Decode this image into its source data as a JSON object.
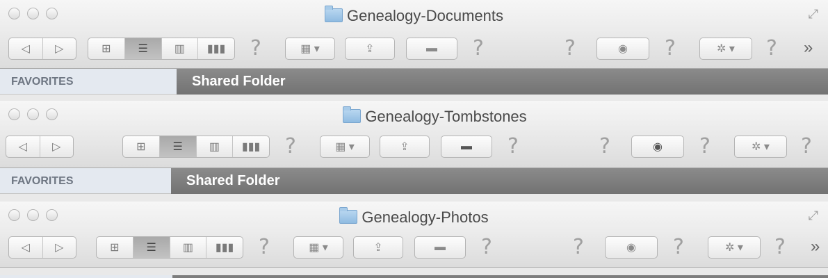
{
  "windows": [
    {
      "title": "Genealogy-Documents",
      "sidebar_heading": "FAVORITES",
      "path_label": "Shared Folder",
      "toolbar": {
        "back": "◁",
        "forward": "▷",
        "help_glyph": "?",
        "more_glyph": "»"
      }
    },
    {
      "title": "Genealogy-Tombstones",
      "sidebar_heading": "FAVORITES",
      "path_label": "Shared Folder",
      "toolbar": {
        "back": "◁",
        "forward": "▷",
        "help_glyph": "?"
      }
    },
    {
      "title": "Genealogy-Photos",
      "toolbar": {
        "back": "◁",
        "forward": "▷",
        "help_glyph": "?",
        "more_glyph": "»"
      }
    }
  ],
  "icons": {
    "view_selected": "list",
    "arrange": "arrange-icon",
    "share": "share-icon",
    "tag": "tag-icon",
    "quicklook": "eye-icon",
    "action": "gear-icon"
  },
  "colors": {
    "pathbar": "#7d7d7d",
    "sidebar": "#e4e9f0"
  }
}
